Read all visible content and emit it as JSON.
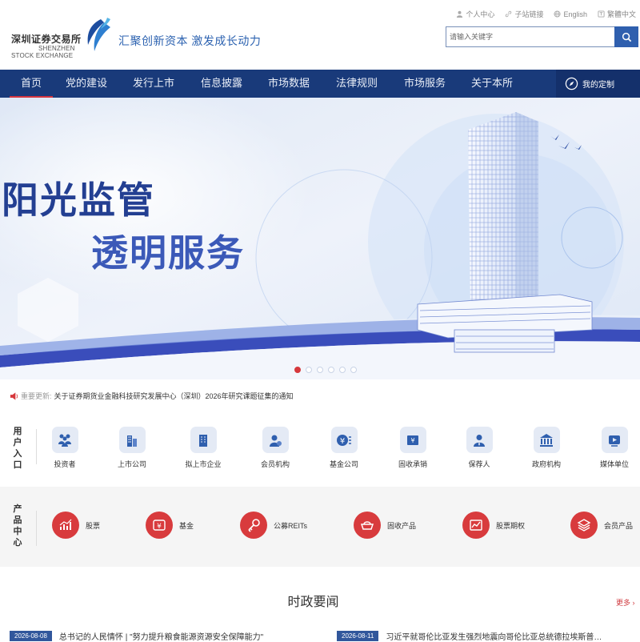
{
  "header": {
    "logo_cn": "深圳证券交易所",
    "logo_en_1": "SHENZHEN",
    "logo_en_2": "STOCK EXCHANGE",
    "slogan": "汇聚创新资本 激发成长动力",
    "top_links": [
      "个人中心",
      "子站链接",
      "English",
      "繁體中文"
    ],
    "search_placeholder": "请输入关键字"
  },
  "nav": {
    "items": [
      "首页",
      "党的建设",
      "发行上市",
      "信息披露",
      "市场数据",
      "法律规则",
      "市场服务",
      "关于本所"
    ],
    "active_index": 0,
    "custom_label": "我的定制"
  },
  "banner": {
    "line1": "阳光监管",
    "line2": "透明服务",
    "slide_count": 6,
    "active_slide": 0
  },
  "notice": {
    "label": "重要更新:",
    "text": "关于证券期货业金融科技研究发展中心（深圳）2026年研究课题征集的通知"
  },
  "user_entry": {
    "title": "用户入口",
    "items": [
      {
        "label": "投资者",
        "icon": "investor-icon"
      },
      {
        "label": "上市公司",
        "icon": "listed-company-icon"
      },
      {
        "label": "拟上市企业",
        "icon": "pre-listing-icon"
      },
      {
        "label": "会员机构",
        "icon": "member-institution-icon"
      },
      {
        "label": "基金公司",
        "icon": "fund-company-icon"
      },
      {
        "label": "固收承销",
        "icon": "fixed-income-underwriting-icon"
      },
      {
        "label": "保荐人",
        "icon": "sponsor-icon"
      },
      {
        "label": "政府机构",
        "icon": "government-icon"
      },
      {
        "label": "媒体单位",
        "icon": "media-icon"
      }
    ]
  },
  "product_center": {
    "title": "产品中心",
    "items": [
      {
        "label": "股票",
        "icon": "stock-chart-icon"
      },
      {
        "label": "基金",
        "icon": "fund-yuan-icon"
      },
      {
        "label": "公募REITs",
        "icon": "key-icon"
      },
      {
        "label": "固收产品",
        "icon": "ingot-icon"
      },
      {
        "label": "股票期权",
        "icon": "option-chart-icon"
      },
      {
        "label": "会员产品",
        "icon": "layers-icon"
      }
    ]
  },
  "news": {
    "title": "时政要闻",
    "more": "更多",
    "items": [
      {
        "date": "2026-08-08",
        "text": "总书记的人民情怀 | \"努力提升粮食能源资源安全保障能力\""
      },
      {
        "date": "2026-08-11",
        "text": "习近平就哥伦比亚发生强烈地震向哥伦比亚总统德拉埃斯普…"
      }
    ]
  },
  "colors": {
    "nav_bg": "#193a7a",
    "accent_red": "#d83b3d",
    "brand_blue": "#2f5fae",
    "date_badge": "#31579c"
  }
}
